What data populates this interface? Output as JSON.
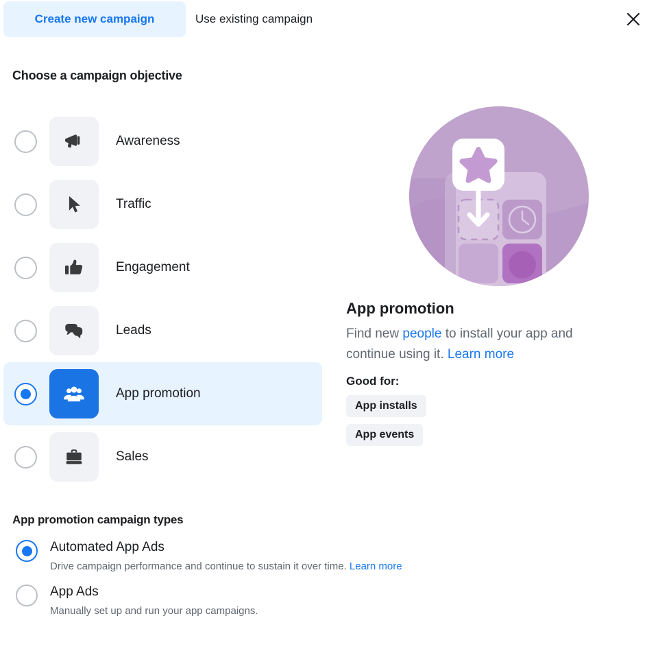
{
  "tabs": [
    {
      "label": "Create new campaign",
      "active": true
    },
    {
      "label": "Use existing campaign",
      "active": false
    }
  ],
  "close_label": "×",
  "objective_section": {
    "title": "Choose a campaign objective",
    "items": [
      {
        "label": "Awareness",
        "icon": "megaphone-icon",
        "selected": false
      },
      {
        "label": "Traffic",
        "icon": "cursor-icon",
        "selected": false
      },
      {
        "label": "Engagement",
        "icon": "thumbs-up-icon",
        "selected": false
      },
      {
        "label": "Leads",
        "icon": "speech-bubbles-icon",
        "selected": false
      },
      {
        "label": "App promotion",
        "icon": "people-group-icon",
        "selected": true
      },
      {
        "label": "Sales",
        "icon": "briefcase-icon",
        "selected": false
      }
    ]
  },
  "detail": {
    "illustration": "app-promotion-illustration",
    "title": "App promotion",
    "desc_part1": "Find new ",
    "desc_link1": "people",
    "desc_part2": " to install your app and continue using it. ",
    "desc_link2": "Learn more",
    "good_for_label": "Good for:",
    "badges": [
      "App installs",
      "App events"
    ]
  },
  "campaign_types": {
    "title": "App promotion campaign types",
    "items": [
      {
        "name": "Automated App Ads",
        "desc": "Drive campaign performance and continue to sustain it over time. ",
        "link": "Learn more",
        "selected": true
      },
      {
        "name": "App Ads",
        "desc": "Manually set up and run your app campaigns.",
        "link": "",
        "selected": false
      }
    ]
  },
  "colors": {
    "accent": "#1877f2",
    "tile_selected": "#1b74e4",
    "highlight": "#e7f3ff",
    "tile_bg": "#f0f2f5",
    "text": "#1c1e21",
    "muted": "#606770",
    "illustration_purple": "#c0a3cd"
  }
}
